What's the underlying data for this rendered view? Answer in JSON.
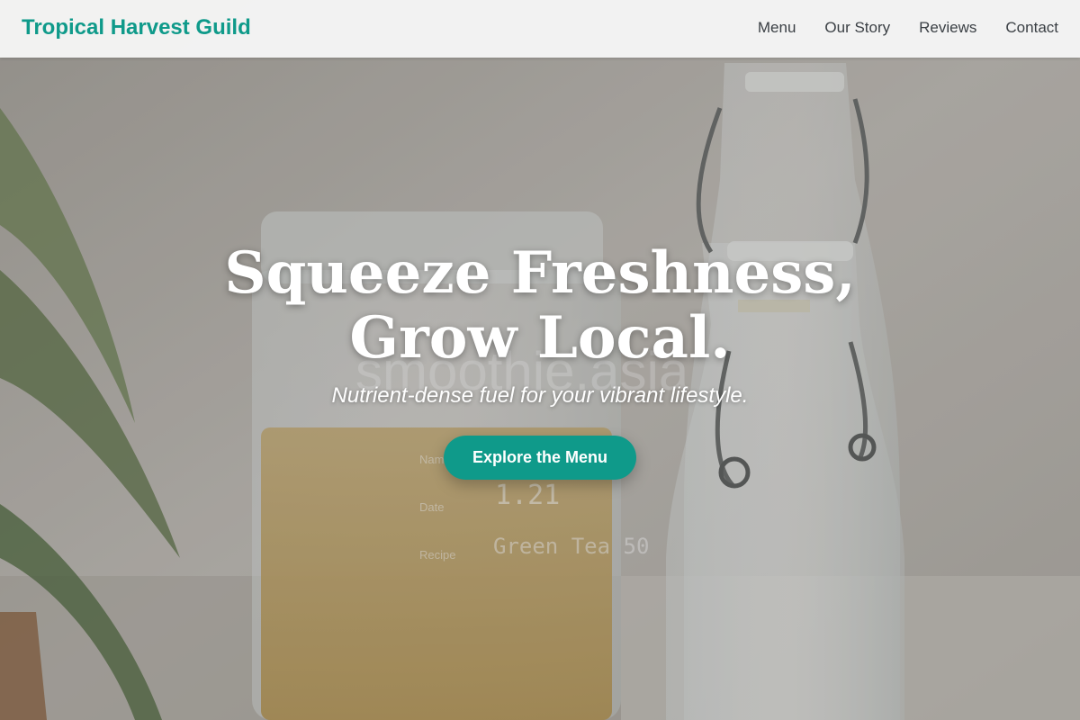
{
  "brand": {
    "name": "Tropical Harvest Guild",
    "color": "#0f9a8a"
  },
  "nav": {
    "items": [
      {
        "label": "Menu"
      },
      {
        "label": "Our Story"
      },
      {
        "label": "Reviews"
      },
      {
        "label": "Contact"
      }
    ]
  },
  "hero": {
    "headline": "Squeeze Freshness, Grow Local.",
    "tagline": "Nutrient-dense fuel for your vibrant lifestyle.",
    "cta_label": "Explore the Menu",
    "background": {
      "watermark_text": "smoothie.asia",
      "label_name": "Name",
      "label_date": "Date",
      "label_recipe": "Recipe",
      "handwritten_date": "1.21",
      "handwritten_recipe": "Green Tea 50"
    }
  }
}
